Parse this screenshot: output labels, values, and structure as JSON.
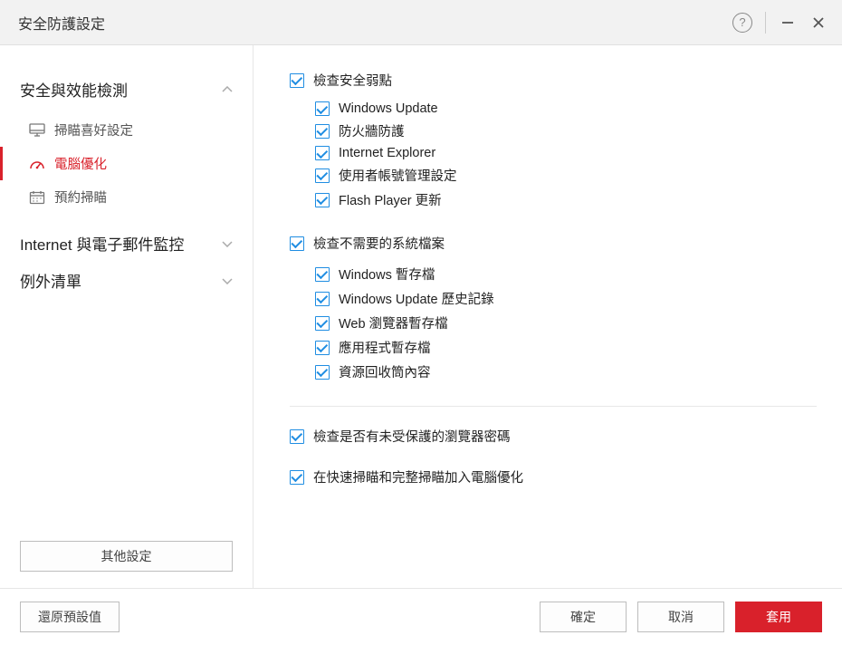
{
  "titlebar": {
    "title": "安全防護設定"
  },
  "sidebar": {
    "section1": {
      "title": "安全與效能檢測",
      "items": [
        {
          "label": "掃瞄喜好設定"
        },
        {
          "label": "電腦優化"
        },
        {
          "label": "預約掃瞄"
        }
      ]
    },
    "section2": {
      "title": "Internet 與電子郵件監控"
    },
    "section3": {
      "title": "例外清單"
    },
    "other_button": "其他設定"
  },
  "content": {
    "group1": {
      "label": "檢查安全弱點",
      "items": [
        "Windows Update",
        "防火牆防護",
        "Internet Explorer",
        "使用者帳號管理設定",
        "Flash Player 更新"
      ]
    },
    "group2": {
      "label": "檢查不需要的系統檔案",
      "items": [
        "Windows 暫存檔",
        "Windows Update 歷史記錄",
        "Web 瀏覽器暫存檔",
        "應用程式暫存檔",
        "資源回收筒內容"
      ]
    },
    "check3": "檢查是否有未受保護的瀏覽器密碼",
    "check4": "在快速掃瞄和完整掃瞄加入電腦優化"
  },
  "footer": {
    "restore": "還原預設值",
    "ok": "確定",
    "cancel": "取消",
    "apply": "套用"
  }
}
